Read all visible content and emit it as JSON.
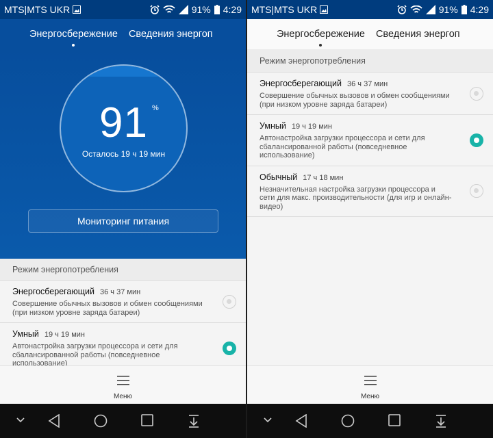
{
  "status_bar": {
    "carrier": "MTS|MTS UKR",
    "battery": "91%",
    "time": "4:29"
  },
  "tabs": {
    "power_saving": "Энергосбережение",
    "power_info": "Сведения энергоп"
  },
  "gauge": {
    "percent": "91",
    "percent_unit": "%",
    "remaining": "Осталось 19 ч 19 мин"
  },
  "monitor_button": "Мониторинг питания",
  "section_title": "Режим энергопотребления",
  "modes": [
    {
      "name": "Энергосберегающий",
      "time": "36 ч 37 мин",
      "desc": "Совершение обычных вызовов и обмен сообщениями (при низком уровне заряда батареи)",
      "selected": false
    },
    {
      "name": "Умный",
      "time": "19 ч 19 мин",
      "desc": "Автонастройка загрузки процессора и сети для сбалансированной работы (повседневное использование)",
      "selected": true
    },
    {
      "name": "Обычный",
      "time": "17 ч 18 мин",
      "desc": "Незначительная настройка загрузки процессора и сети для макс. производительности (для игр и онлайн-видео)",
      "selected": false
    }
  ],
  "menu_label": "Меню",
  "colors": {
    "primary_blue": "#074e9d",
    "accent_teal": "#18b3a8"
  }
}
